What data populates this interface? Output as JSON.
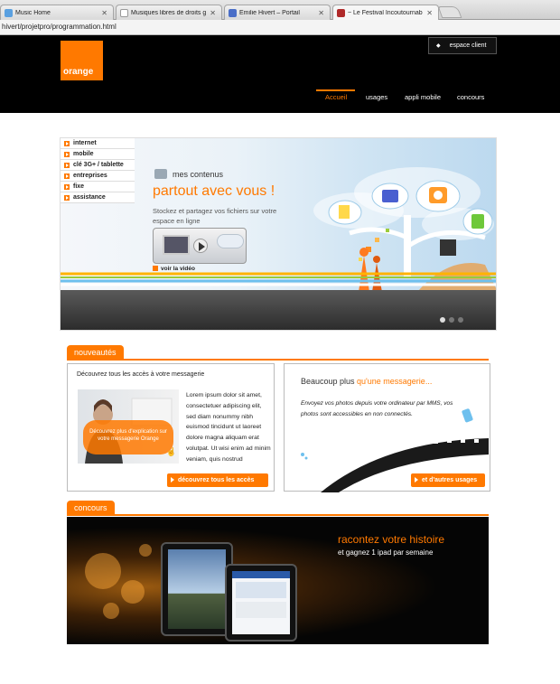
{
  "browser": {
    "tabs": [
      {
        "title": "Music Home",
        "favicon_color": "#5aa0e0",
        "active": false
      },
      {
        "title": "Musiques libres de droits gr",
        "favicon_color": "#cccccc",
        "active": false
      },
      {
        "title": "Emilie Hivert – Portail",
        "favicon_color": "#4a6ec7",
        "active": false
      },
      {
        "title": "~ Le Festival Incoutournabl",
        "favicon_color": "#b02a2a",
        "active": true
      }
    ],
    "url": "hivert/projetpro/programmation.html"
  },
  "header": {
    "logo_text": "orange",
    "espace_client": "espace client",
    "nav": [
      "Accueil",
      "usages",
      "appli mobile",
      "concours"
    ],
    "nav_active": "Accueil"
  },
  "hero": {
    "menu": [
      "internet",
      "mobile",
      "clé 3G+ / tablette",
      "entreprises",
      "fixe",
      "assistance"
    ],
    "kicker": "mes contenus",
    "headline": "partout avec vous !",
    "description": "Stockez et partagez vos fichiers sur votre espace en ligne",
    "video_link": "voir la vidéo",
    "slides": 3,
    "active_slide": 1
  },
  "nouveautes": {
    "tab": "nouveautés",
    "left_box": {
      "heading": "Découvrez tous les accès à votre messagerie",
      "image_caption": "Découvrez plus d'explication sur votre messagerie Orange",
      "body": "Lorem ipsum dolor sit amet, consectetuer adipiscing elit, sed diam nonummy nibh euismod tincidunt ut laoreet dolore magna aliquam erat volutpat. Ut wisi enim ad minim veniam, quis nostrud",
      "button": "découvrez tous les accès"
    },
    "right_box": {
      "heading_plain": "Beaucoup plus ",
      "heading_accent": "qu'une messagerie...",
      "body": "Envoyez vos photos depuis votre ordinateur par MMS, vos photos sont accessibles en non connectés.",
      "button": "et d'autres usages"
    }
  },
  "concours": {
    "tab": "concours",
    "title": "racontez votre histoire",
    "subtitle": "et gagnez 1 ipad par semaine"
  },
  "colors": {
    "accent": "#ff7900",
    "header_bg": "#000000"
  }
}
